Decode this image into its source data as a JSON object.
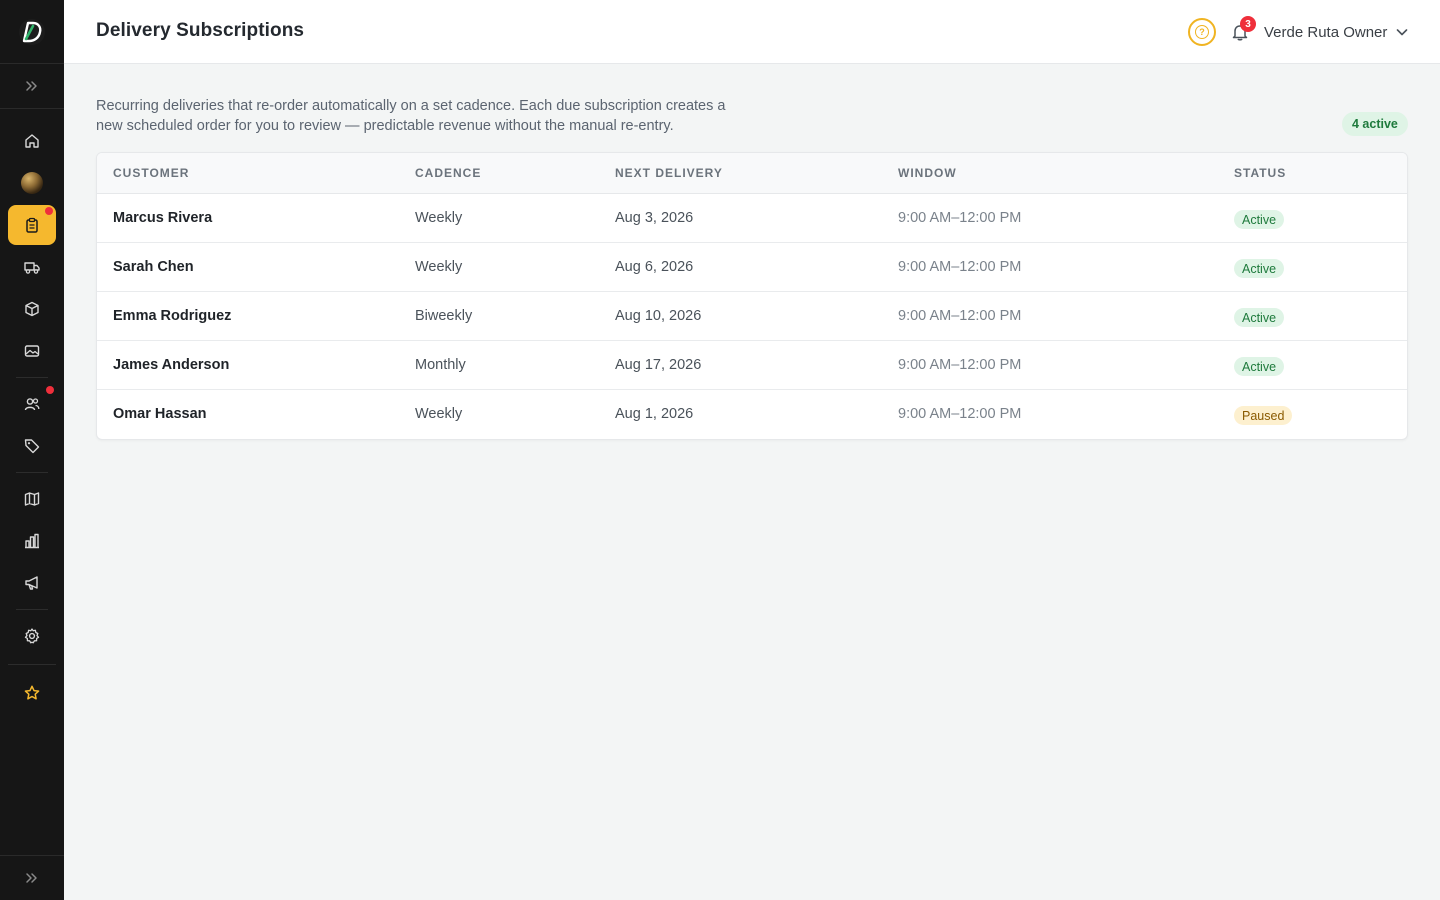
{
  "app": {
    "logo_icon": "brand-d-icon"
  },
  "header": {
    "title": "Delivery Subscriptions",
    "notifications_count": "3",
    "user_name": "Verde Ruta Owner"
  },
  "sidebar": {
    "items": [
      {
        "icon": "expand-icon"
      },
      {
        "icon": "home-icon"
      },
      {
        "icon": "store-avatar"
      },
      {
        "icon": "clipboard-icon",
        "active": true,
        "has_alert": true
      },
      {
        "icon": "truck-icon"
      },
      {
        "icon": "box-icon"
      },
      {
        "icon": "image-icon"
      },
      {
        "icon": "users-icon",
        "has_alert": true
      },
      {
        "icon": "tag-icon"
      },
      {
        "icon": "map-icon"
      },
      {
        "icon": "bar-chart-icon"
      },
      {
        "icon": "megaphone-icon"
      },
      {
        "icon": "settings-icon"
      },
      {
        "icon": "star-icon"
      },
      {
        "icon": "collapse-icon"
      }
    ]
  },
  "main": {
    "description": "Recurring deliveries that re-order automatically on a set cadence. Each due subscription creates a new scheduled order for you to review — predictable revenue without the manual re-entry.",
    "active_count_label": "4 active",
    "columns": [
      "CUSTOMER",
      "CADENCE",
      "NEXT DELIVERY",
      "WINDOW",
      "STATUS"
    ],
    "rows": [
      {
        "customer": "Marcus Rivera",
        "cadence": "Weekly",
        "next_delivery": "Aug 3, 2026",
        "window": "9:00 AM–12:00 PM",
        "status": "Active"
      },
      {
        "customer": "Sarah Chen",
        "cadence": "Weekly",
        "next_delivery": "Aug 6, 2026",
        "window": "9:00 AM–12:00 PM",
        "status": "Active"
      },
      {
        "customer": "Emma Rodriguez",
        "cadence": "Biweekly",
        "next_delivery": "Aug 10, 2026",
        "window": "9:00 AM–12:00 PM",
        "status": "Active"
      },
      {
        "customer": "James Anderson",
        "cadence": "Monthly",
        "next_delivery": "Aug 17, 2026",
        "window": "9:00 AM–12:00 PM",
        "status": "Active"
      },
      {
        "customer": "Omar Hassan",
        "cadence": "Weekly",
        "next_delivery": "Aug 1, 2026",
        "window": "9:00 AM–12:00 PM",
        "status": "Paused"
      }
    ]
  },
  "colors": {
    "accent": "#f5b82e",
    "sidebar_bg": "#161616",
    "active_badge": "#dff4e6",
    "paused_badge": "#fdf0cf",
    "alert_dot": "#ef2f3b"
  }
}
